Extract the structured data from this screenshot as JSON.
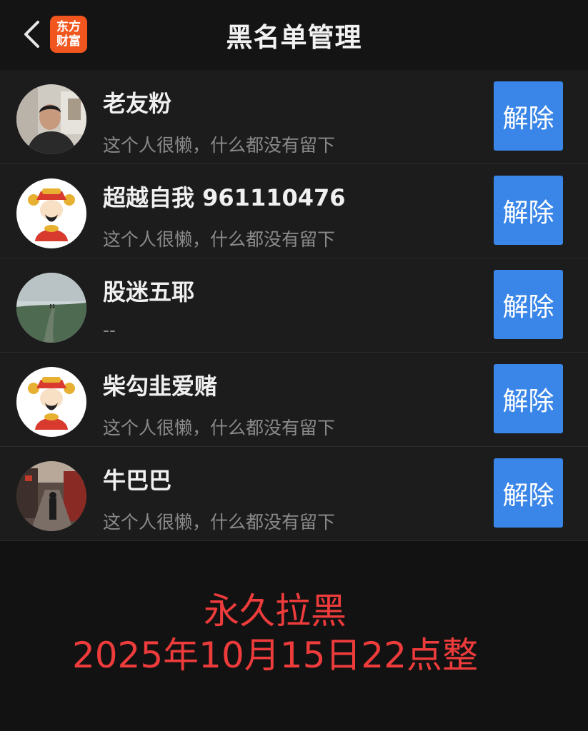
{
  "header": {
    "title": "黑名单管理",
    "logo_line1": "东方",
    "logo_line2": "财富"
  },
  "blacklist": {
    "button_label": "解除",
    "items": [
      {
        "name": "老友粉",
        "desc": "这个人很懒，什么都没有留下",
        "avatar": "photo-man"
      },
      {
        "name": "超越自我 961110476",
        "desc": "这个人很懒，什么都没有留下",
        "avatar": "cartoon-fortune-god"
      },
      {
        "name": "股迷五耶",
        "desc": "--",
        "avatar": "landscape-path"
      },
      {
        "name": "柴勾韭爱赌",
        "desc": "这个人很懒，什么都没有留下",
        "avatar": "cartoon-fortune-god"
      },
      {
        "name": "牛巴巴",
        "desc": "这个人很懒，什么都没有留下",
        "avatar": "street-scene"
      }
    ]
  },
  "notice": {
    "line1": "永久拉黑",
    "line2": "2025年10月15日22点整"
  },
  "colors": {
    "background": "#121212",
    "row_background": "#1c1c1c",
    "button": "#3a86e8",
    "logo": "#f0561e",
    "notice": "#ee3b3b"
  }
}
